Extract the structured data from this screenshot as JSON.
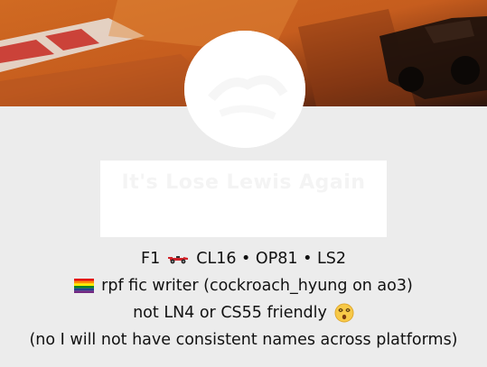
{
  "header": {
    "banner_image": "f1-car-track-banner",
    "avatar_image": "blog-avatar"
  },
  "blog": {
    "title": "It's Lose Lewis Again"
  },
  "bio": {
    "line1_part1": "F1",
    "line1_part2": "CL16 • OP81 • LS2",
    "line2": "rpf fic writer (cockroach_hyung on ao3)",
    "line3": "not LN4 or CS55 friendly",
    "line4": "(no I will not have consistent names across platforms)"
  },
  "icons": {
    "car": "race-car-icon",
    "flag": "rainbow-flag-icon",
    "face": "dizzy-face-icon"
  },
  "colors": {
    "background": "#ececec",
    "banner_orange": "#d8772a",
    "text": "#111111"
  }
}
